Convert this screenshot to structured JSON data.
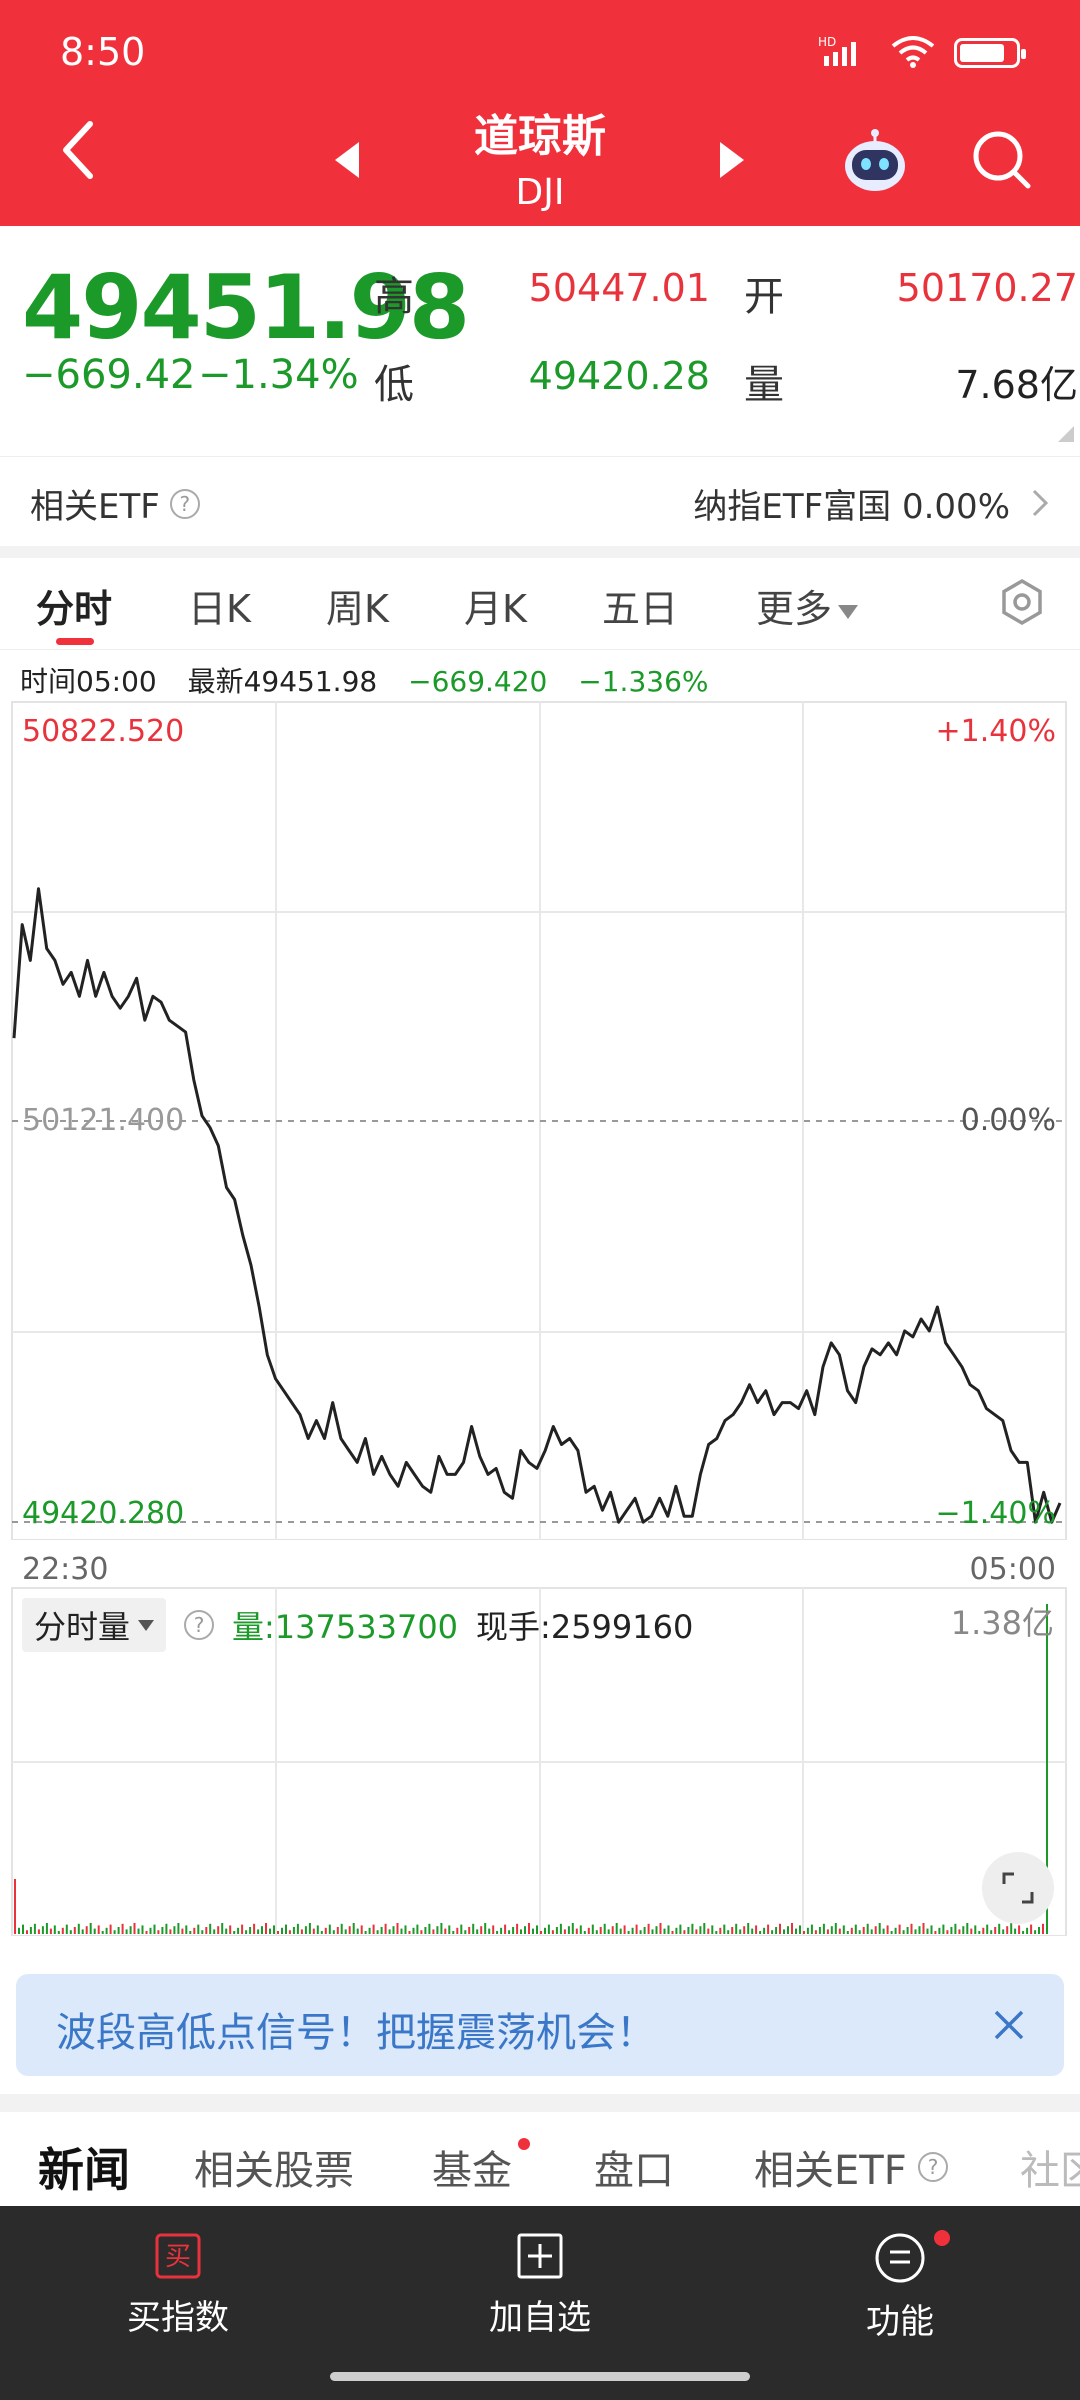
{
  "status_bar": {
    "time": "8:50",
    "network": "HD"
  },
  "header": {
    "title": "道琼斯",
    "subtitle": "DJI"
  },
  "quote": {
    "price": "49451.98",
    "change": "−669.42",
    "change_pct": "−1.34%",
    "high_label": "高",
    "high": "50447.01",
    "open_label": "开",
    "open": "50170.27",
    "low_label": "低",
    "low": "49420.28",
    "volume_label": "量",
    "volume": "7.68亿"
  },
  "etf": {
    "label": "相关ETF",
    "related_name": "纳指ETF富国",
    "related_pct": "0.00%"
  },
  "tabs": [
    "分时",
    "日K",
    "周K",
    "月K",
    "五日",
    "更多"
  ],
  "info": {
    "time": "时间05:00",
    "latest": "最新49451.98",
    "change": "−669.420",
    "change_pct": "−1.336%"
  },
  "chart_labels": {
    "max_price": "50822.520",
    "max_pct": "+1.40%",
    "mid_price": "50121.400",
    "mid_pct": "0.00%",
    "min_price": "49420.280",
    "min_pct": "−1.40%",
    "start_time": "22:30",
    "end_time": "05:00"
  },
  "chart_data": {
    "type": "line",
    "x_range": [
      "22:30",
      "05:00"
    ],
    "ylim": [
      49420.28,
      50822.52
    ],
    "reference": 50121.4,
    "values": [
      50230,
      50420,
      50360,
      50480,
      50380,
      50360,
      50320,
      50340,
      50300,
      50360,
      50300,
      50340,
      50300,
      50280,
      50300,
      50330,
      50260,
      50300,
      50290,
      50260,
      50250,
      50240,
      50160,
      50100,
      50080,
      50050,
      49980,
      49960,
      49900,
      49850,
      49780,
      49700,
      49660,
      49640,
      49620,
      49600,
      49560,
      49590,
      49560,
      49620,
      49560,
      49540,
      49520,
      49560,
      49500,
      49530,
      49500,
      49480,
      49520,
      49500,
      49480,
      49470,
      49530,
      49500,
      49500,
      49520,
      49580,
      49530,
      49500,
      49510,
      49470,
      49460,
      49540,
      49520,
      49510,
      49540,
      49580,
      49550,
      49560,
      49540,
      49470,
      49480,
      49440,
      49470,
      49420,
      49440,
      49460,
      49420,
      49430,
      49460,
      49430,
      49480,
      49430,
      49430,
      49500,
      49550,
      49560,
      49590,
      49600,
      49620,
      49650,
      49620,
      49640,
      49600,
      49620,
      49620,
      49610,
      49640,
      49600,
      49680,
      49720,
      49700,
      49640,
      49620,
      49680,
      49710,
      49700,
      49720,
      49700,
      49740,
      49730,
      49760,
      49740,
      49780,
      49720,
      49700,
      49680,
      49650,
      49640,
      49610,
      49600,
      49590,
      49540,
      49520,
      49520,
      49420,
      49470,
      49420,
      49452
    ],
    "volume": {
      "label": "分时量",
      "current": "量:137533700",
      "hand": "现手:2599160",
      "max_label": "1.38亿"
    }
  },
  "banner": {
    "text": "波段高低点信号！把握震荡机会！"
  },
  "news_tabs": [
    "新闻",
    "相关股票",
    "基金",
    "盘口",
    "相关ETF",
    "社区"
  ],
  "bottom_nav": {
    "buy": "买指数",
    "buy_icon_text": "买",
    "add": "加自选",
    "func": "功能"
  },
  "colors": {
    "header": "#f0313c",
    "up": "#e8323c",
    "down": "#1b9a29",
    "banner_bg": "#dce9fb",
    "banner_text": "#3a77c8"
  }
}
